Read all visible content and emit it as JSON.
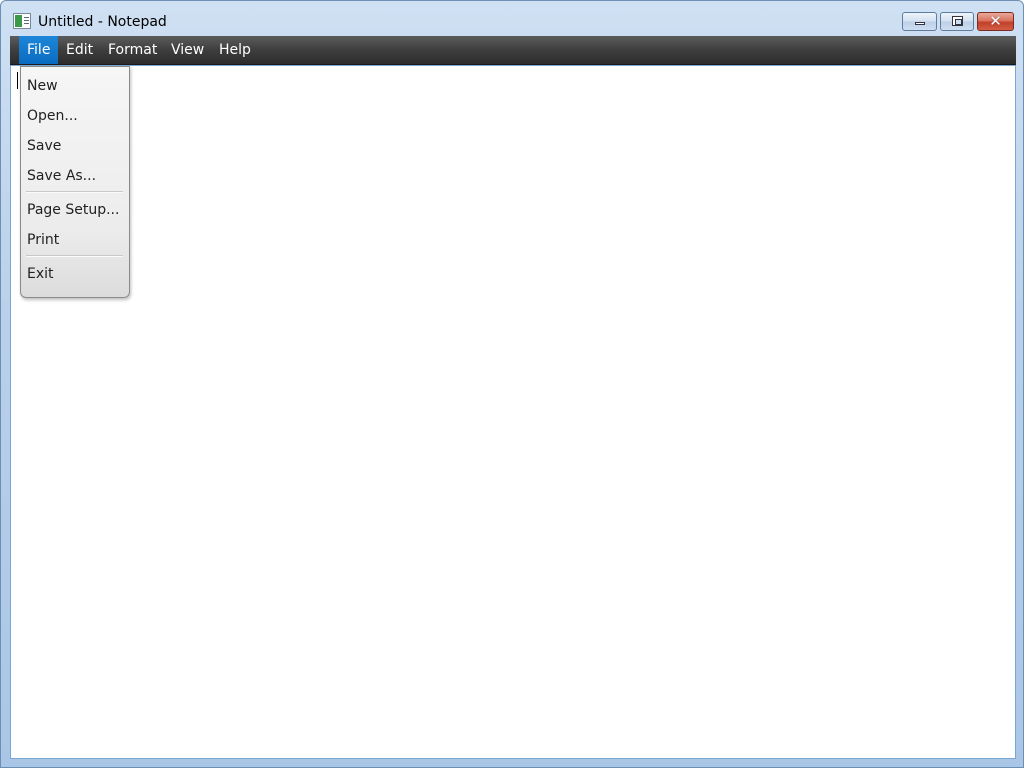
{
  "window": {
    "title": "Untitled - Notepad",
    "app_icon": "notepad-icon",
    "controls": {
      "minimize_icon": "minimize-icon",
      "maximize_icon": "maximize-icon",
      "close_icon": "close-icon",
      "close_glyph": "✕"
    }
  },
  "menubar": {
    "items": [
      {
        "label": "File",
        "active": true
      },
      {
        "label": "Edit",
        "active": false
      },
      {
        "label": "Format",
        "active": false
      },
      {
        "label": "View",
        "active": false
      },
      {
        "label": "Help",
        "active": false
      }
    ]
  },
  "file_menu": {
    "items": [
      {
        "label": "New"
      },
      {
        "label": "Open..."
      },
      {
        "label": "Save"
      },
      {
        "label": "Save As..."
      },
      {
        "label": "Page Setup..."
      },
      {
        "label": "Print"
      },
      {
        "label": "Exit"
      }
    ]
  },
  "editor": {
    "text": ""
  },
  "colors": {
    "menubar_bg": "#3e3e3e",
    "menu_active": "#0a6cc0",
    "close_button": "#c2402a"
  }
}
